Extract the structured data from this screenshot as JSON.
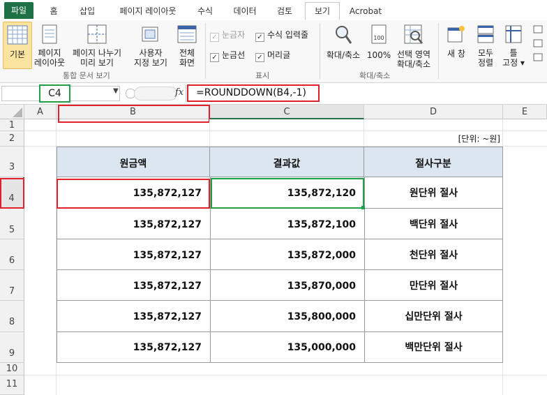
{
  "ribbon_tabs": [
    "파일",
    "홈",
    "삽입",
    "페이지 레이아웃",
    "수식",
    "데이터",
    "검토",
    "보기",
    "Acrobat"
  ],
  "ribbon": {
    "views": {
      "normal": "기본",
      "page_layout": [
        "페이지",
        "레이아웃"
      ],
      "page_break": [
        "페이지 나누기",
        "미리 보기"
      ],
      "custom": [
        "사용자",
        "지정 보기"
      ],
      "full": [
        "전체",
        "화면"
      ],
      "group_label": "통합 문서 보기"
    },
    "show": {
      "ruler": "눈금자",
      "formula_bar": "수식 입력줄",
      "gridlines": "눈금선",
      "headings": "머리글",
      "group_label": "표시"
    },
    "zoom": {
      "zoom": "확대/축소",
      "hundred": "100%",
      "selection": [
        "선택 영역",
        "확대/축소"
      ],
      "group_label": "확대/축소"
    },
    "window": {
      "new_window": "새 창",
      "arrange_all": [
        "모두",
        "정렬"
      ],
      "freeze": [
        "틀",
        "고정 ▾"
      ]
    }
  },
  "formula_bar": {
    "name_box": "C4",
    "fx": "fx",
    "formula": "=ROUNDDOWN(B4,-1)"
  },
  "columns": [
    "A",
    "B",
    "C",
    "D",
    "E"
  ],
  "rows": [
    "1",
    "2",
    "3",
    "4",
    "5",
    "6",
    "7",
    "8",
    "9",
    "10",
    "11"
  ],
  "sheet": {
    "unit_note": "[단위: ~원]",
    "headers": [
      "원금액",
      "결과값",
      "절사구분"
    ],
    "data": [
      {
        "original": "135,872,127",
        "result": "135,872,120",
        "type": "원단위 절사"
      },
      {
        "original": "135,872,127",
        "result": "135,872,100",
        "type": "백단위 절사"
      },
      {
        "original": "135,872,127",
        "result": "135,872,000",
        "type": "천단위 절사"
      },
      {
        "original": "135,872,127",
        "result": "135,870,000",
        "type": "만단위 절사"
      },
      {
        "original": "135,872,127",
        "result": "135,800,000",
        "type": "십만단위 절사"
      },
      {
        "original": "135,872,127",
        "result": "135,000,000",
        "type": "백만단위 절사"
      }
    ]
  },
  "colors": {
    "file_tab": "#1e7145",
    "header_fill": "#dce6f1",
    "highlight_red": "#e0202a",
    "highlight_green": "#1fa046",
    "selected_button": "#fbe3a0"
  }
}
